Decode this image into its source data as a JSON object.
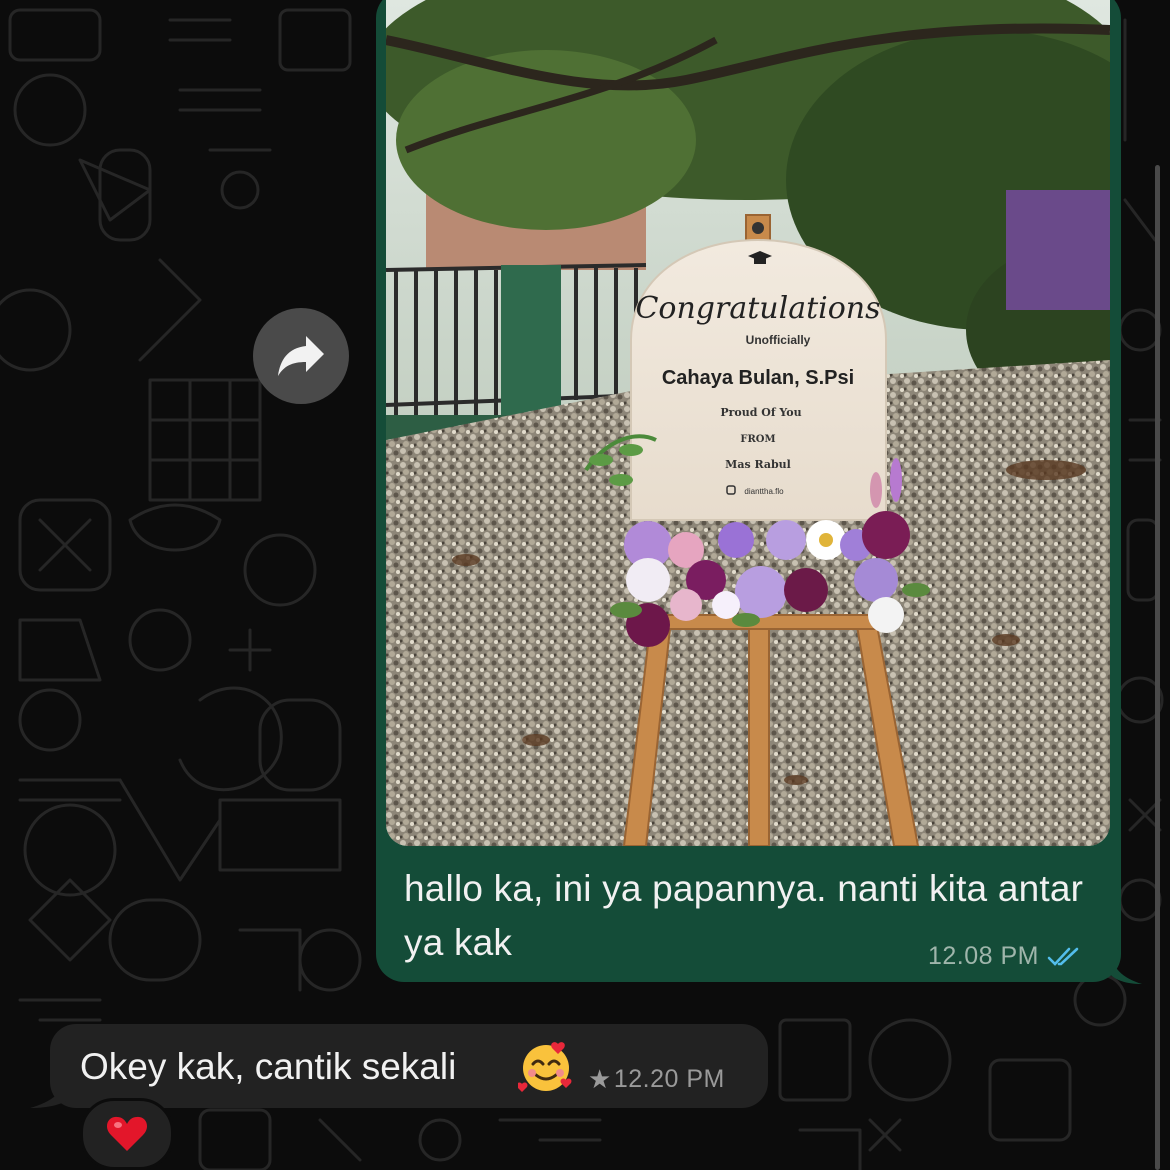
{
  "messages": {
    "outgoing": {
      "text": "hallo ka, ini ya papannya. nanti kita antar ya kak",
      "time": "12.08 PM",
      "status_icon": "double-check-read-icon",
      "photo": {
        "sign_title": "Congratulations",
        "sign_subtitle": "Unofficially",
        "sign_name": "Cahaya Bulan, S.Psi",
        "sign_line1": "Proud Of You",
        "sign_line2": "FROM",
        "sign_from": "Mas Rabul",
        "sign_handle": "dianttha.flo"
      }
    },
    "incoming": {
      "text": "Okey kak, cantik sekali",
      "emoji": "smiling-face-with-hearts",
      "time": "12.20 PM",
      "starred_icon": "star-icon",
      "reaction": "red-heart"
    }
  },
  "colors": {
    "outgoing_bubble": "#144c38",
    "incoming_bubble": "#222222",
    "background": "#0c0c0c",
    "read_ticks": "#53bdeb"
  }
}
